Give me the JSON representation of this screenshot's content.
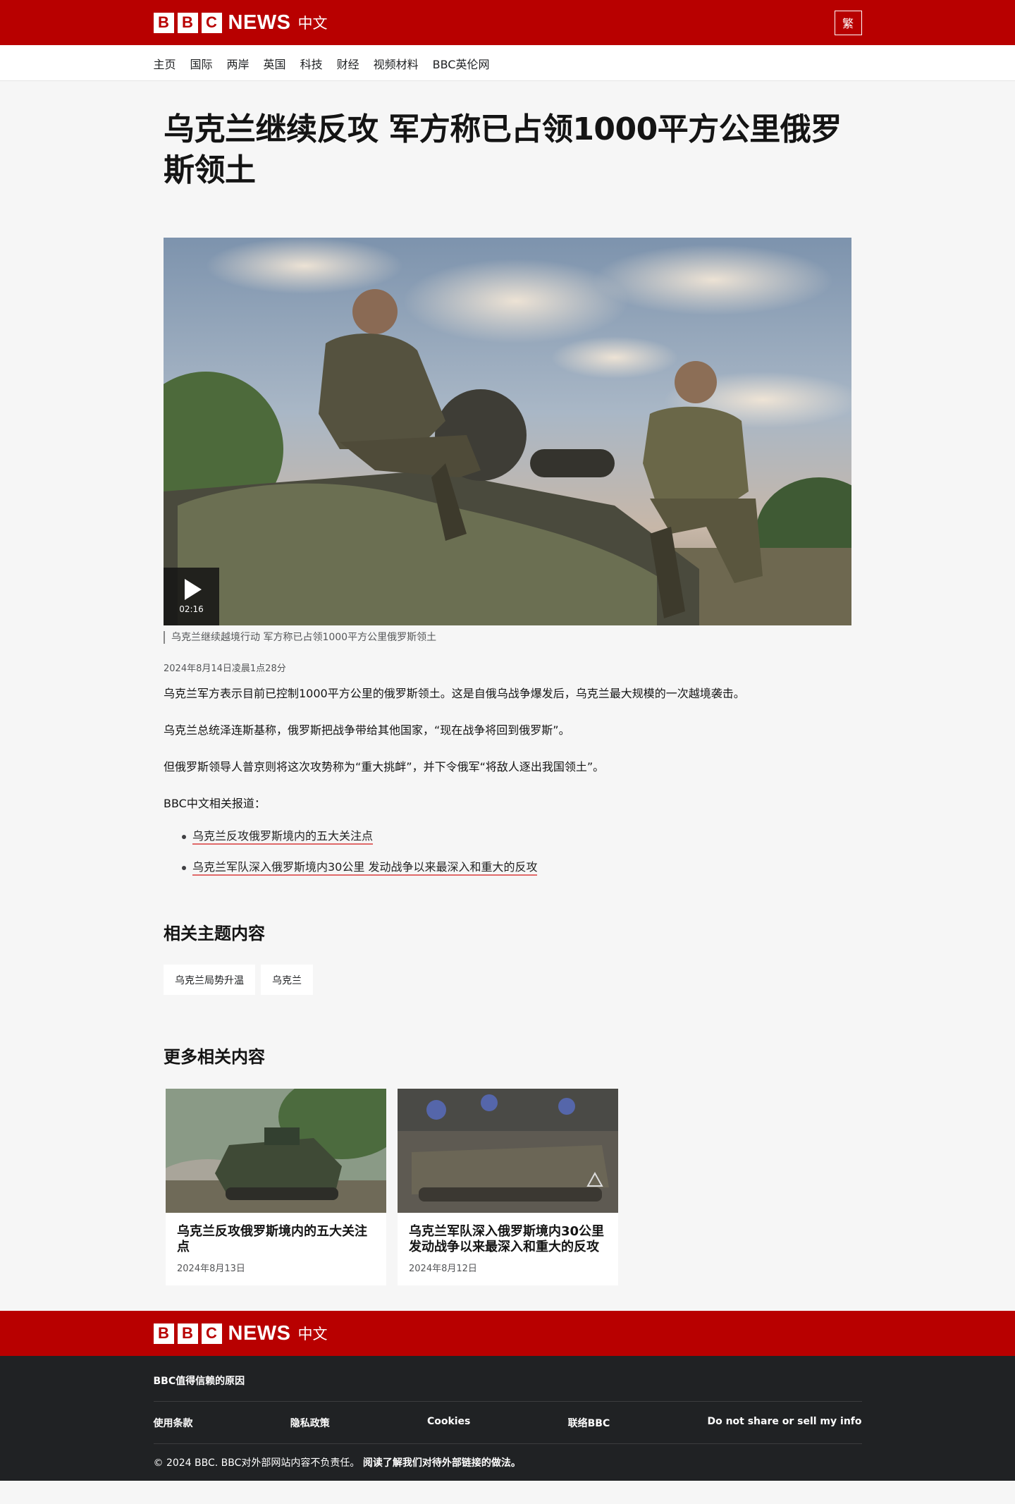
{
  "header": {
    "brand_blocks": [
      "B",
      "B",
      "C"
    ],
    "brand_news": "NEWS",
    "brand_lang": "中文",
    "lang_toggle": "繁"
  },
  "nav": {
    "items": [
      "主页",
      "国际",
      "两岸",
      "英国",
      "科技",
      "财经",
      "视频材料",
      "BBC英伦网"
    ]
  },
  "article": {
    "headline": "乌克兰继续反攻 军方称已占领1000平方公里俄罗斯领土",
    "video_duration": "02:16",
    "caption": "乌克兰继续越境行动 军方称已占领1000平方公里俄罗斯领土",
    "date": "2024年8月14日凌晨1点28分",
    "paragraphs": [
      "乌克兰军方表示目前已控制1000平方公里的俄罗斯领土。这是自俄乌战争爆发后，乌克兰最大规模的一次越境袭击。",
      "乌克兰总统泽连斯基称，俄罗斯把战争带给其他国家，“现在战争将回到俄罗斯”。",
      "但俄罗斯领导人普京则将这次攻势称为“重大挑衅”，并下令俄军“将敌人逐出我国领土”。",
      "BBC中文相关报道："
    ],
    "related_links": [
      "乌克兰反攻俄罗斯境内的五大关注点",
      "乌克兰军队深入俄罗斯境内30公里 发动战争以来最深入和重大的反攻"
    ]
  },
  "topics": {
    "title": "相关主题内容",
    "pills": [
      "乌克兰局势升温",
      "乌克兰"
    ]
  },
  "more": {
    "title": "更多相关内容",
    "cards": [
      {
        "title": "乌克兰反攻俄罗斯境内的五大关注点",
        "date": "2024年8月13日"
      },
      {
        "title": "乌克兰军队深入俄罗斯境内30公里 发动战争以来最深入和重大的反攻",
        "date": "2024年8月12日"
      }
    ]
  },
  "footer": {
    "why": "BBC值得信赖的原因",
    "links": [
      "使用条款",
      "隐私政策",
      "Cookies",
      "联络BBC",
      "Do not share or sell my info"
    ],
    "copyright": "© 2024 BBC. BBC对外部网站内容不负责任。",
    "copyright_link": "阅读了解我们对待外部链接的做法。"
  },
  "colors": {
    "brand_red": "#b80000",
    "footer_dark": "#202224",
    "link_underline": "#e06a6a"
  }
}
